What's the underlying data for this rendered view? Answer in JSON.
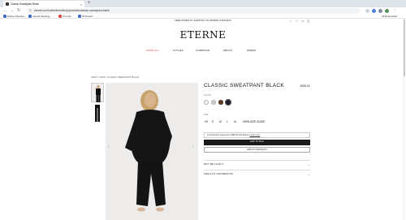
{
  "browser": {
    "tab_title": "Classic Sweatpant Black",
    "url": "eterne.com/collections/shop/products/classic-sweatpant-black",
    "bookmarks": [
      "Enfuse Meeting",
      "Launch Meeting",
      "Tonmail",
      "All Panels"
    ],
    "all_bookmarks_label": "All Bookmarks"
  },
  "promo": {
    "text": "FREE DOMESTIC SHIPPING ON ORDERS OVER $100"
  },
  "logo": {
    "text": "ETERNE"
  },
  "nav": {
    "items": [
      "SHOP ALL",
      "STYLES",
      "CAMPAIGN",
      "ABOUT",
      "PRESS"
    ]
  },
  "breadcrumb": {
    "text": "SHOP  /  SHOP  /  CLASSIC SWEATPANT BLACK"
  },
  "product": {
    "title": "CLASSIC SWEATPANT BLACK",
    "price": "$225.00",
    "color_label": "COLOR:",
    "swatch_colors": [
      "#f2f2f2",
      "#c9c9c9",
      "#5a3b24",
      "#1b1b2a"
    ],
    "size_label": "SIZE:",
    "sizes": [
      "XS",
      "S",
      "M",
      "L",
      "XL"
    ],
    "size_guide": "VIEW SIZE GUIDE",
    "installment_text": "4 interest-free payments of $56.25 with Klarna.",
    "installment_link": "Learn more",
    "add_to_bag": "ADD TO BAG",
    "add_to_wishlist": "ADD TO WISHLIST",
    "accordions": [
      "WHY WE LOVE IT",
      "SIZE & FIT INFORMATION"
    ]
  },
  "icons": {
    "header": [
      "search-icon",
      "heart-icon",
      "user-icon",
      "bag-icon"
    ]
  }
}
